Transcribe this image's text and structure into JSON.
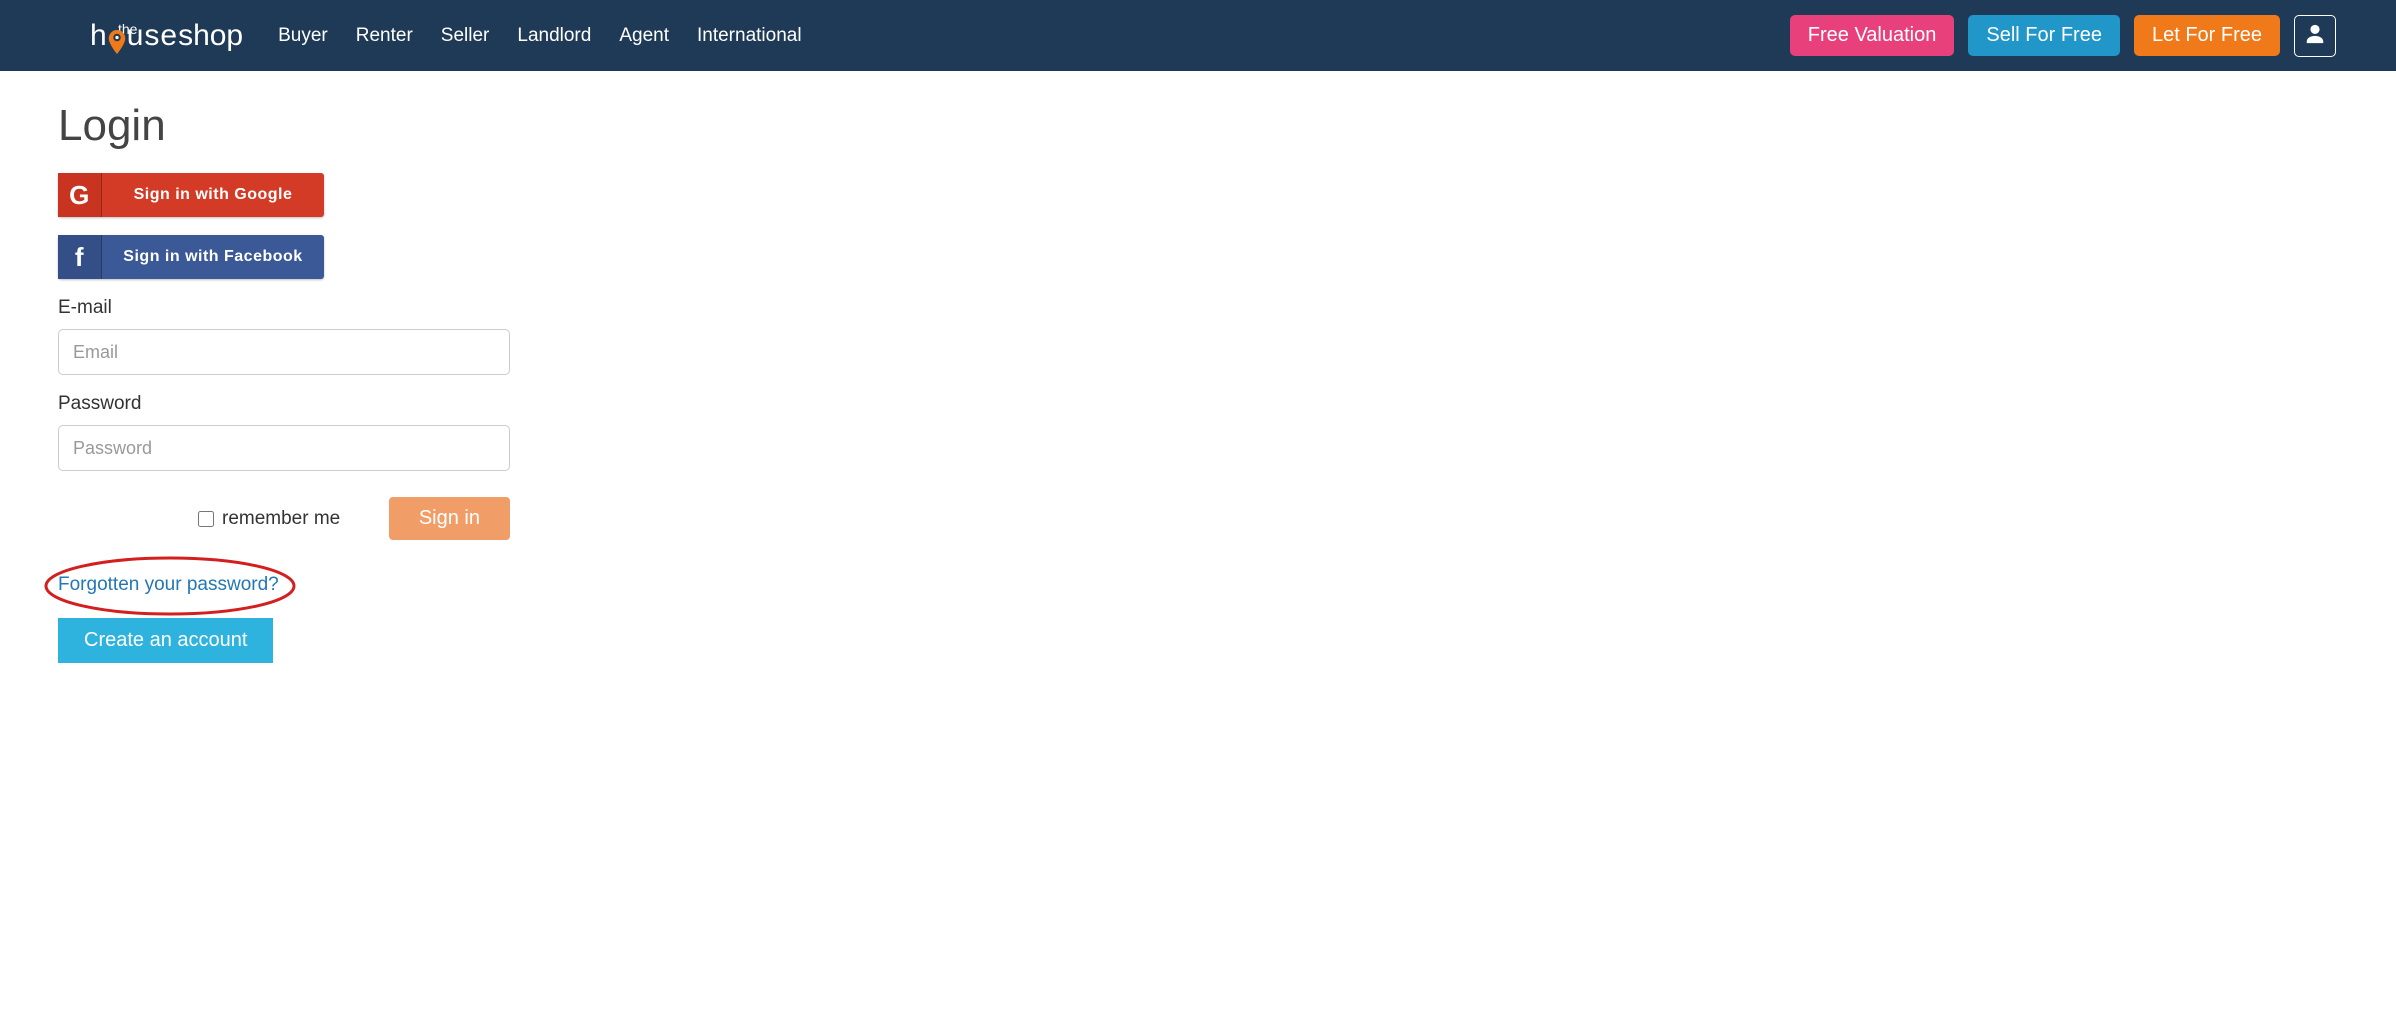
{
  "nav": {
    "logo": {
      "the": "the",
      "house": "h",
      "use": "use",
      "shop": "shop"
    },
    "links": [
      "Buyer",
      "Renter",
      "Seller",
      "Landlord",
      "Agent",
      "International"
    ],
    "ctas": {
      "valuation": "Free Valuation",
      "sell": "Sell For Free",
      "let": "Let For Free"
    }
  },
  "login": {
    "title": "Login",
    "google_label": "Sign in with Google",
    "fb_label": "Sign in with Facebook",
    "email_label": "E-mail",
    "email_ph": "Email",
    "pw_label": "Password",
    "pw_ph": "Password",
    "remember": "remember me",
    "signin": "Sign in",
    "forgot": "Forgotten your password?",
    "create": "Create an account"
  }
}
